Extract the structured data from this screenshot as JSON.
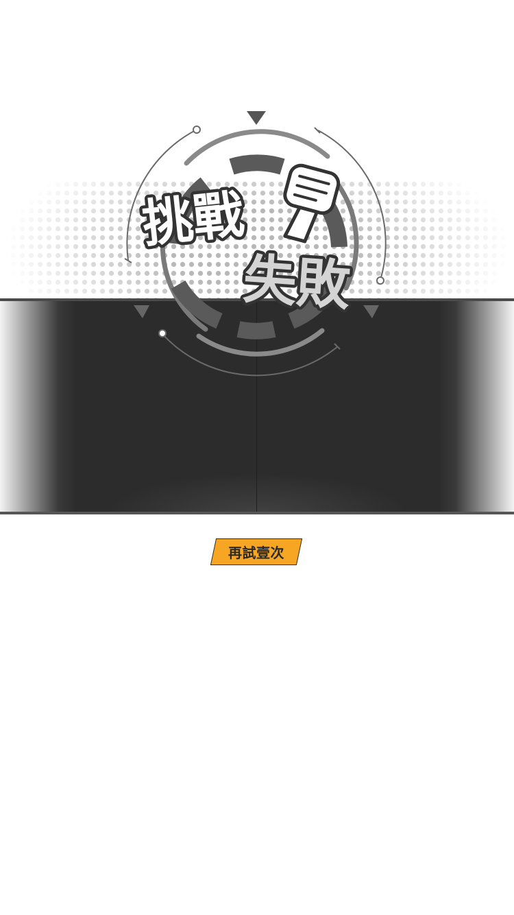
{
  "title": {
    "line1": "挑戰",
    "line2": "失敗"
  },
  "emblem": {
    "icon": "fist-icon"
  },
  "retry_button": {
    "label": "再試壹次",
    "color": "#f6a623"
  },
  "colors": {
    "panel": "#2c2c2c",
    "halftone": "#b7b7b7",
    "ring": "#6a6a6a"
  }
}
